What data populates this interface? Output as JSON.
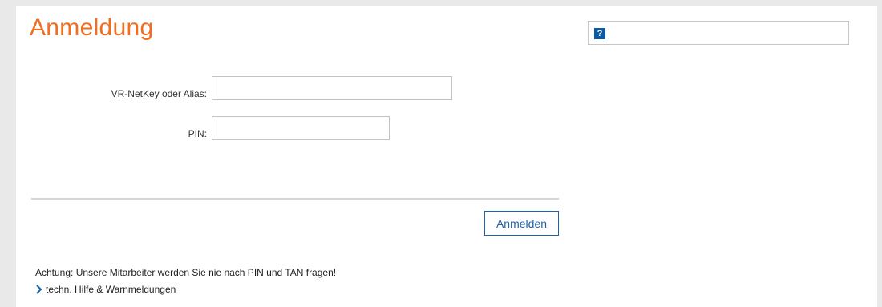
{
  "page": {
    "title": "Anmeldung"
  },
  "help": {
    "icon_glyph": "?",
    "icon_color": "#0b5aa6"
  },
  "form": {
    "netkey_label": "VR-NetKey oder Alias:",
    "netkey_value": "",
    "pin_label": "PIN:",
    "pin_value": "",
    "submit_label": "Anmelden"
  },
  "footer": {
    "warning": "Achtung: Unsere Mitarbeiter werden Sie nie nach PIN und TAN fragen!",
    "help_link_label": "techn. Hilfe & Warnmeldungen"
  },
  "colors": {
    "title_accent": "#f06e1e",
    "link_blue": "#1c62a8",
    "background": "#e9e9e9"
  },
  "icons": {
    "help": "question-mark-icon",
    "link": "chevron-right-icon"
  }
}
